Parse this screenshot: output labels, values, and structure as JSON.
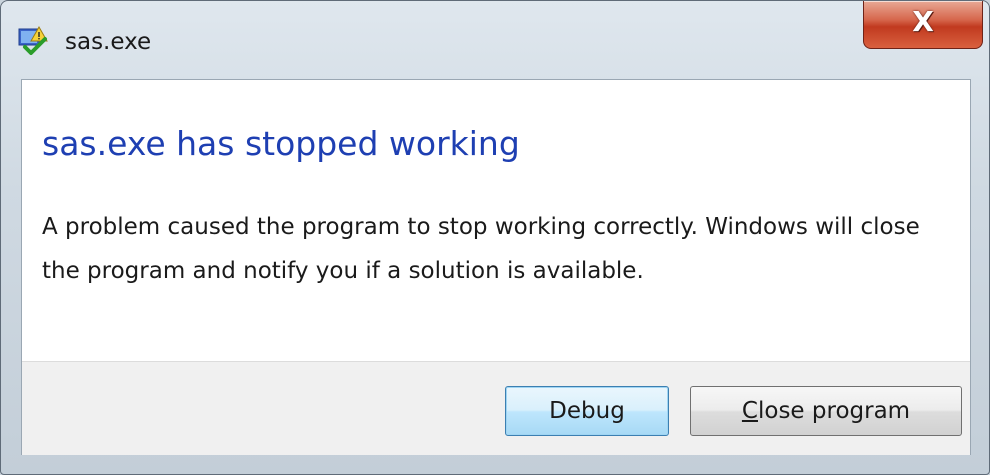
{
  "window": {
    "title": "sas.exe",
    "close_glyph": "X",
    "icon": "app-crash-icon"
  },
  "dialog": {
    "heading": "sas.exe has stopped working",
    "message": "A problem caused the program to stop working correctly. Windows will close the program and notify you if a solution is available."
  },
  "buttons": {
    "debug_label": "Debug",
    "close_program_first": "C",
    "close_program_rest": "lose program"
  },
  "colors": {
    "heading": "#1e3fb2",
    "close_button": "#c13a1f",
    "default_button_border": "#3c7fb1"
  }
}
